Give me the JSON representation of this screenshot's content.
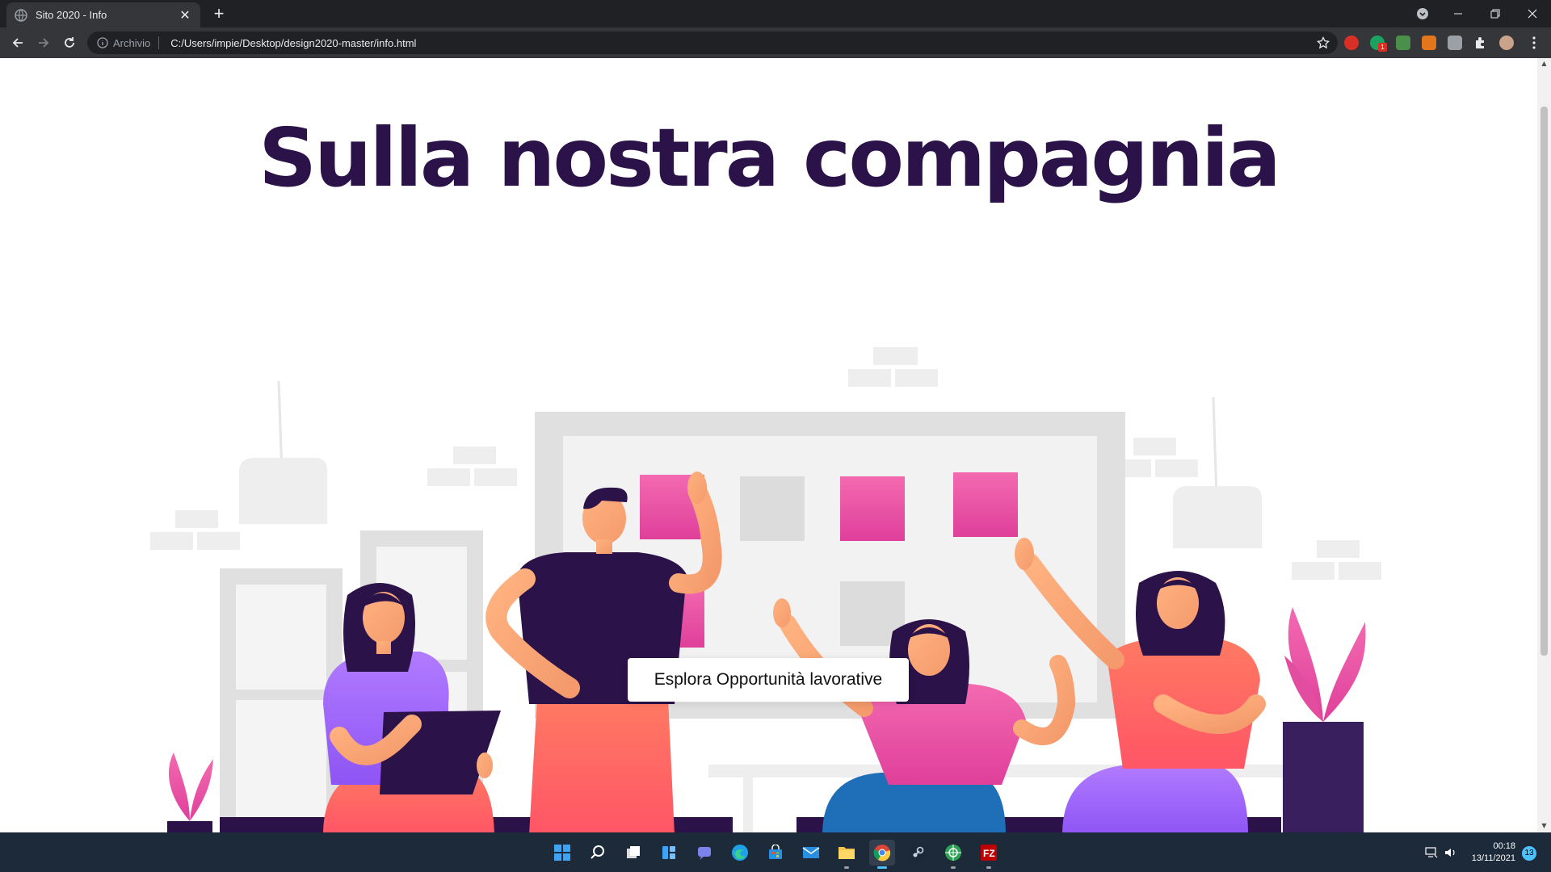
{
  "browser": {
    "tab_title": "Sito 2020 - Info",
    "new_tab_symbol": "+",
    "close_symbol": "✕",
    "secure_label": "Archivio",
    "url": "C:/Users/impie/Desktop/design2020-master/info.html",
    "extension_badge": "1"
  },
  "page": {
    "title": "Sulla nostra compagnia",
    "cta_label": "Esplora Opportunità lavorative"
  },
  "taskbar": {
    "time": "00:18",
    "date": "13/11/2021",
    "notification_count": "13"
  },
  "colors": {
    "title": "#2b1248",
    "dark_purple": "#2b1248",
    "pink": "#e84c9c",
    "coral": "#ff6b6b",
    "skin": "#f7a072",
    "lavender": "#a36bf0",
    "blue": "#1e6fb8",
    "light_gray": "#e6e6e6"
  }
}
